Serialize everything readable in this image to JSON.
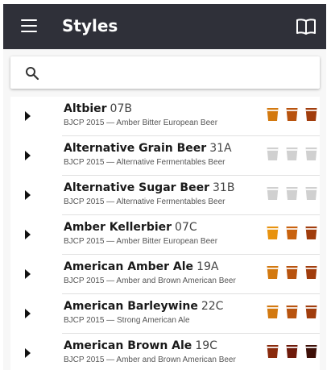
{
  "header": {
    "title": "Styles",
    "menu_icon": "menu-icon",
    "book_icon": "book-icon"
  },
  "search": {
    "placeholder": "",
    "value": "",
    "icon": "search-icon"
  },
  "colors": {
    "appbar": "#2f3039",
    "empty_glass": "#d0d0d0"
  },
  "styles": [
    {
      "name": "Altbier",
      "code": "07B",
      "category": "BJCP 2015 — Amber Bitter European Beer",
      "glass_colors": [
        "#d3790f",
        "#b8530e",
        "#a13d0d"
      ]
    },
    {
      "name": "Alternative Grain Beer",
      "code": "31A",
      "category": "BJCP 2015 — Alternative Fermentables Beer",
      "glass_colors": [
        "#d0d0d0",
        "#d0d0d0",
        "#d0d0d0"
      ]
    },
    {
      "name": "Alternative Sugar Beer",
      "code": "31B",
      "category": "BJCP 2015 — Alternative Fermentables Beer",
      "glass_colors": [
        "#d0d0d0",
        "#d0d0d0",
        "#d0d0d0"
      ]
    },
    {
      "name": "Amber Kellerbier",
      "code": "07C",
      "category": "BJCP 2015 — Amber Bitter European Beer",
      "glass_colors": [
        "#e8930f",
        "#c9620e",
        "#a13d0d"
      ]
    },
    {
      "name": "American Amber Ale",
      "code": "19A",
      "category": "BJCP 2015 — Amber and Brown American Beer",
      "glass_colors": [
        "#d3790f",
        "#b8530e",
        "#a13d0d"
      ]
    },
    {
      "name": "American Barleywine",
      "code": "22C",
      "category": "BJCP 2015 — Strong American Ale",
      "glass_colors": [
        "#d3790f",
        "#b8530e",
        "#a13d0d"
      ]
    },
    {
      "name": "American Brown Ale",
      "code": "19C",
      "category": "BJCP 2015 — Amber and Brown American Beer",
      "glass_colors": [
        "#8a2a0c",
        "#6e1a0a",
        "#3e1008"
      ]
    }
  ]
}
